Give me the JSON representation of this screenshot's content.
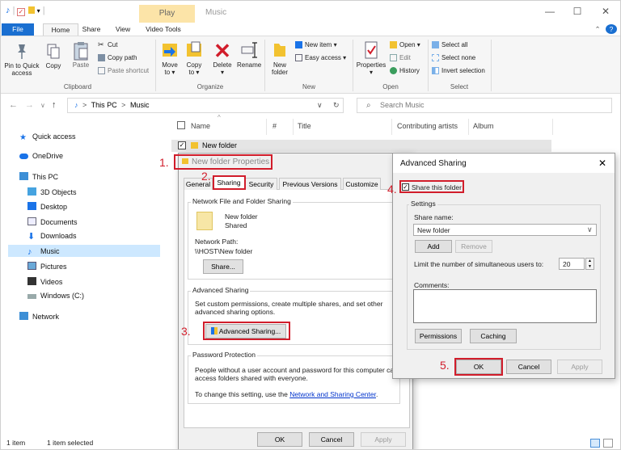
{
  "window": {
    "title": "Music",
    "contextual_tab": "Play"
  },
  "ribbon_tabs": [
    "File",
    "Home",
    "Share",
    "View",
    "Video Tools"
  ],
  "ribbon": {
    "clipboard": {
      "pin": "Pin to Quick\naccess",
      "copy": "Copy",
      "paste": "Paste",
      "cut": "Cut",
      "copy_path": "Copy path",
      "paste_shortcut": "Paste shortcut",
      "label": "Clipboard"
    },
    "organize": {
      "move_to": "Move\nto ▾",
      "copy_to": "Copy\nto ▾",
      "delete": "Delete\n▾",
      "rename": "Rename",
      "label": "Organize"
    },
    "new": {
      "new_folder": "New\nfolder",
      "new_item": "New item ▾",
      "easy_access": "Easy access ▾",
      "label": "New"
    },
    "open": {
      "properties": "Properties\n▾",
      "open": "Open ▾",
      "edit": "Edit",
      "history": "History",
      "label": "Open"
    },
    "select": {
      "select_all": "Select all",
      "select_none": "Select none",
      "invert": "Invert selection",
      "label": "Select"
    }
  },
  "address": {
    "path_root": "This PC",
    "path_sep": ">",
    "path_leaf": "Music",
    "search_placeholder": "Search Music"
  },
  "nav": {
    "quick_access": "Quick access",
    "onedrive": "OneDrive",
    "this_pc": "This PC",
    "objects3d": "3D Objects",
    "desktop": "Desktop",
    "documents": "Documents",
    "downloads": "Downloads",
    "music": "Music",
    "pictures": "Pictures",
    "videos": "Videos",
    "windows_c": "Windows (C:)",
    "network": "Network"
  },
  "columns": {
    "name": "Name",
    "num": "#",
    "title": "Title",
    "artists": "Contributing artists",
    "album": "Album"
  },
  "files": [
    {
      "name": "New folder"
    }
  ],
  "status": {
    "items": "1 item",
    "selected": "1 item selected"
  },
  "properties_dialog": {
    "title": "New folder Properties",
    "tabs": [
      "General",
      "Sharing",
      "Security",
      "Previous Versions",
      "Customize"
    ],
    "network_group": "Network File and Folder Sharing",
    "folder_name": "New folder",
    "folder_state": "Shared",
    "network_path_label": "Network Path:",
    "network_path": "\\\\HOST\\New folder",
    "share_btn": "Share...",
    "adv_group": "Advanced Sharing",
    "adv_desc_1": "Set custom permissions, create multiple shares, and set other",
    "adv_desc_2": "advanced sharing options.",
    "adv_btn": "Advanced Sharing...",
    "pw_group": "Password Protection",
    "pw_desc_1": "People without a user account and password for this computer can",
    "pw_desc_2": "access folders shared with everyone.",
    "pw_desc_3": "To change this setting, use the ",
    "pw_link": "Network and Sharing Center",
    "pw_desc_end": ".",
    "ok": "OK",
    "cancel": "Cancel",
    "apply": "Apply"
  },
  "advanced_dialog": {
    "title": "Advanced Sharing",
    "share_this": "Share this folder",
    "settings": "Settings",
    "share_name_label": "Share name:",
    "share_name": "New folder",
    "add": "Add",
    "remove": "Remove",
    "limit_label": "Limit the number of simultaneous users to:",
    "limit_value": "20",
    "comments_label": "Comments:",
    "permissions": "Permissions",
    "caching": "Caching",
    "ok": "OK",
    "cancel": "Cancel",
    "apply": "Apply"
  },
  "steps": [
    "1.",
    "2.",
    "3.",
    "4.",
    "5."
  ]
}
